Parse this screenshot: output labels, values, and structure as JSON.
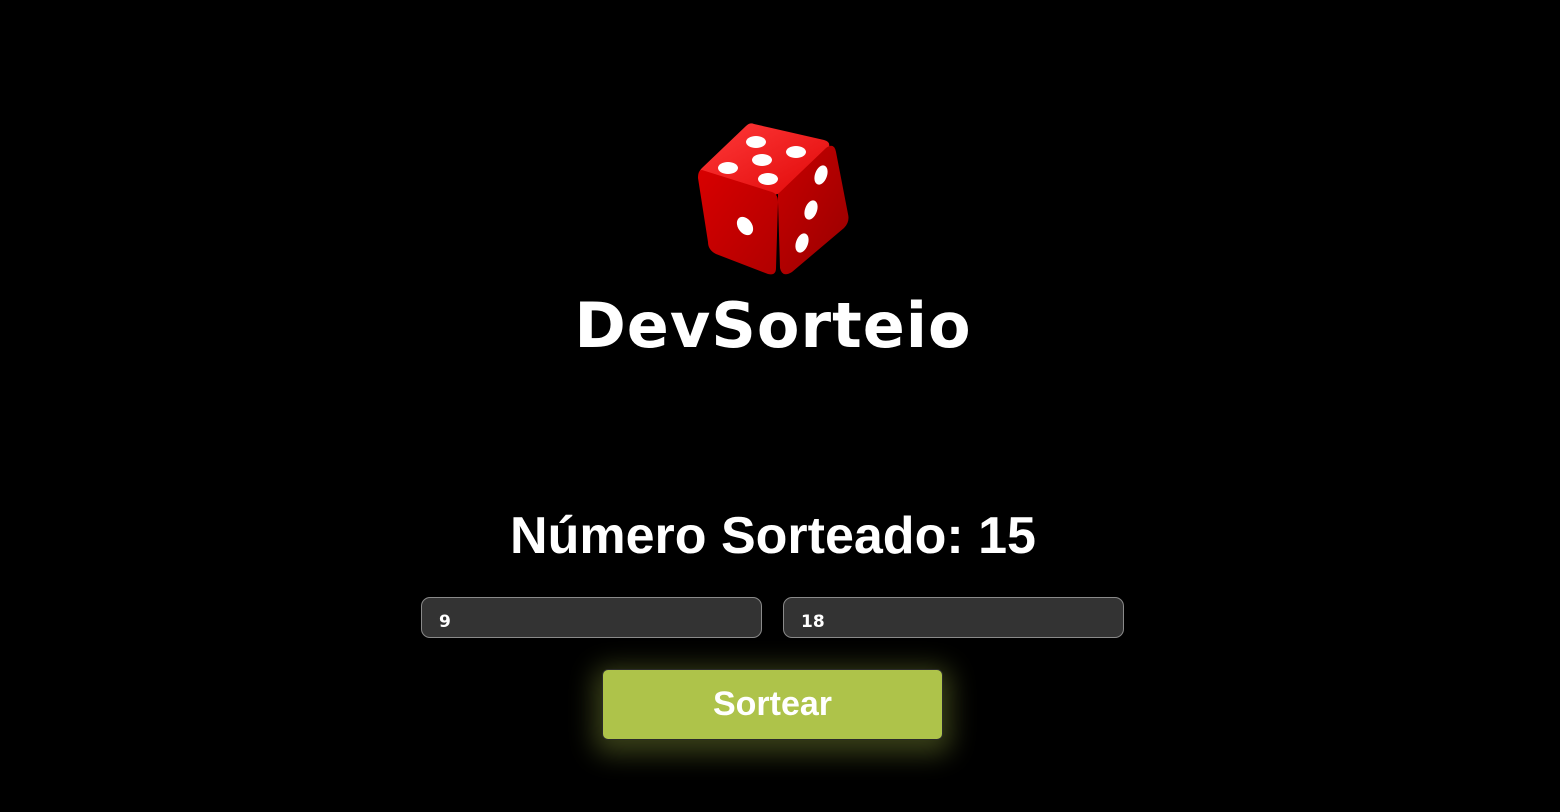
{
  "header": {
    "logo_icon": "dice-icon",
    "title": "DevSorteio"
  },
  "result": {
    "label": "Número Sorteado: 15"
  },
  "form": {
    "min_value": "9",
    "max_value": "18",
    "submit_label": "Sortear"
  },
  "colors": {
    "background": "#000000",
    "accent": "#aec34a",
    "input_background": "#333333",
    "dice": "#e00000"
  }
}
